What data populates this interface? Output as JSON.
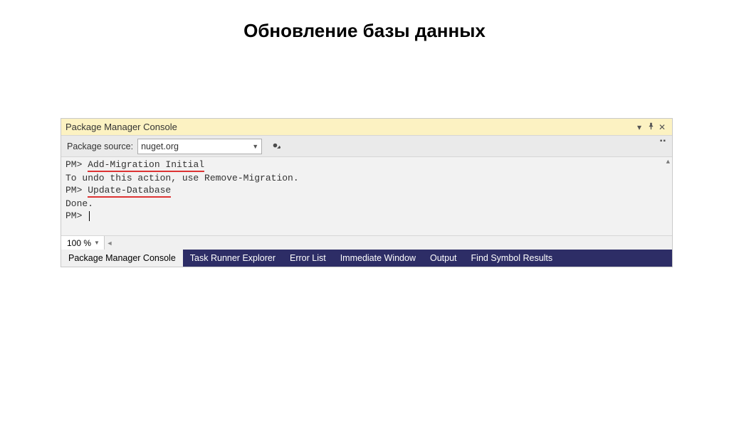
{
  "page": {
    "title": "Обновление базы данных"
  },
  "panel": {
    "title": "Package Manager Console",
    "toolbar": {
      "source_label": "Package source:",
      "source_value": "nuget.org"
    },
    "console": {
      "prompt": "PM>",
      "lines": [
        {
          "type": "cmd",
          "prompt": "PM>",
          "text": "Add-Migration Initial"
        },
        {
          "type": "out",
          "text": "To undo this action, use Remove-Migration."
        },
        {
          "type": "cmd",
          "prompt": "PM>",
          "text": "Update-Database"
        },
        {
          "type": "out",
          "text": "Done."
        },
        {
          "type": "prompt",
          "prompt": "PM>"
        }
      ]
    },
    "zoom": "100 %"
  },
  "tabs": {
    "items": [
      "Package Manager Console",
      "Task Runner Explorer",
      "Error List",
      "Immediate Window",
      "Output",
      "Find Symbol Results"
    ],
    "active_index": 0
  }
}
